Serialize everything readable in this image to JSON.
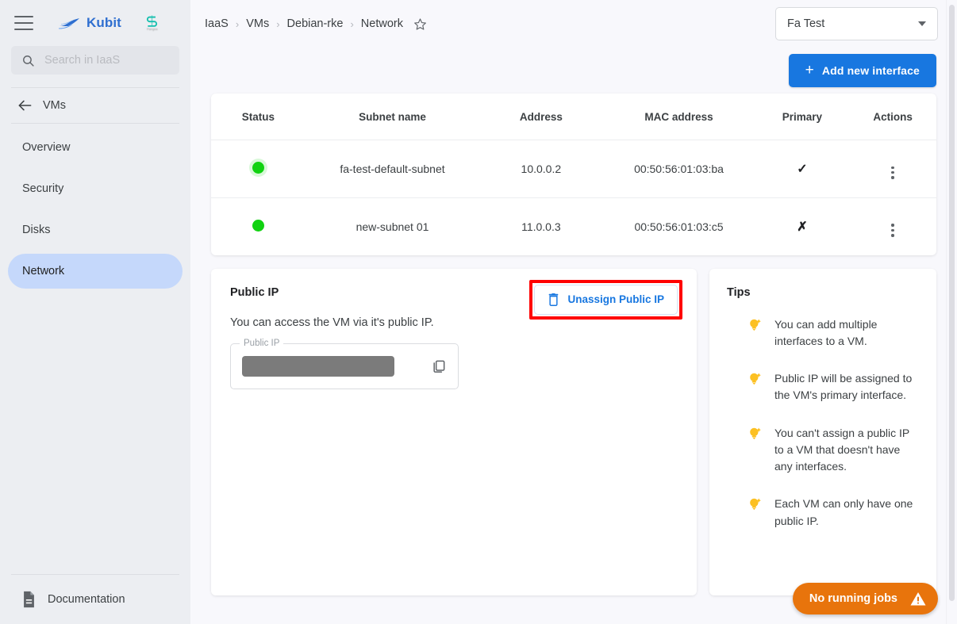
{
  "sidebar": {
    "menu_icon": "hamburger-icon",
    "brand": {
      "name": "Kubit",
      "logo_icon": "kubit-wave-logo"
    },
    "partner_logo": {
      "icon": "partner-s-logo",
      "caption": "Pangea"
    },
    "search": {
      "placeholder": "Search in IaaS",
      "value": "",
      "icon": "search-icon"
    },
    "back": {
      "label": "VMs",
      "icon": "arrow-left-icon"
    },
    "items": [
      {
        "label": "Overview",
        "active": false
      },
      {
        "label": "Security",
        "active": false
      },
      {
        "label": "Disks",
        "active": false
      },
      {
        "label": "Network",
        "active": true
      }
    ],
    "footer": {
      "label": "Documentation",
      "icon": "document-icon"
    }
  },
  "topbar": {
    "breadcrumbs": [
      "IaaS",
      "VMs",
      "Debian-rke",
      "Network"
    ],
    "separator": "›",
    "favorite_icon": "star-outline-icon",
    "account_select": {
      "value": "Fa Test",
      "icon": "chevron-down-icon"
    }
  },
  "actions": {
    "add_interface_label": "Add new interface",
    "add_interface_icon": "plus-icon"
  },
  "table": {
    "columns": [
      "Status",
      "Subnet name",
      "Address",
      "MAC address",
      "Primary",
      "Actions"
    ],
    "rows": [
      {
        "status": "online",
        "subnet_name": "fa-test-default-subnet",
        "address": "10.0.0.2",
        "mac_address": "00:50:56:01:03:ba",
        "primary": "✓",
        "actions_icon": "kebab-menu-icon"
      },
      {
        "status": "online",
        "subnet_name": "new-subnet 01",
        "address": "11.0.0.3",
        "mac_address": "00:50:56:01:03:c5",
        "primary": "✗",
        "actions_icon": "kebab-menu-icon"
      }
    ]
  },
  "public_ip_panel": {
    "title": "Public IP",
    "description": "You can access the VM via it's public IP.",
    "field": {
      "label": "Public IP",
      "value": "",
      "redacted": true,
      "copy_icon": "copy-icon"
    },
    "unassign": {
      "label": "Unassign Public IP",
      "icon": "trash-icon",
      "highlighted": true
    }
  },
  "tips_panel": {
    "title": "Tips",
    "items": [
      "You can add multiple interfaces to a VM.",
      "Public IP will be assigned to the VM's primary interface.",
      "You can't assign a public IP to a VM that doesn't have any interfaces.",
      "Each VM can only have one public IP."
    ],
    "bullet_icon": "lightbulb-icon"
  },
  "jobs_pill": {
    "label": "No running jobs",
    "icon": "warning-triangle-icon"
  },
  "colors": {
    "accent_blue": "#1877e0",
    "brand_blue": "#2f6fd0",
    "sidebar_bg": "#eceef2",
    "active_nav": "#c5d8fb",
    "status_green": "#11d211",
    "tip_yellow": "#fcc022",
    "jobs_orange": "#e8740c",
    "highlight_red": "#ff0000",
    "page_bg": "#f8f8fc"
  }
}
